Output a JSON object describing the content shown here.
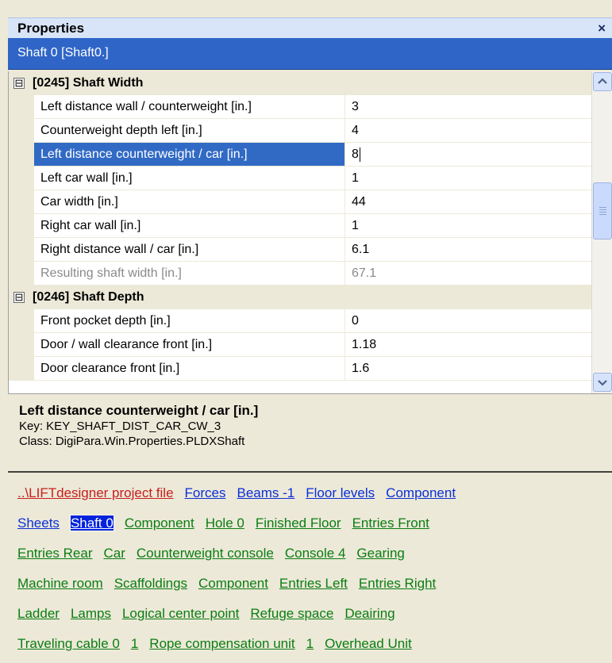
{
  "title": "Properties",
  "close_glyph": "×",
  "object_selector": "Shaft 0 [Shaft0.]",
  "categories": [
    {
      "label": "[0245] Shaft Width",
      "toggle": "⊟",
      "rows": [
        {
          "name": "Left distance wall  / counterweight [in.]",
          "value": "3"
        },
        {
          "name": "Counterweight depth left [in.]",
          "value": "4"
        },
        {
          "name": "Left distance counterweight / car [in.]",
          "value": "8"
        },
        {
          "name": "Left car wall [in.]",
          "value": "1"
        },
        {
          "name": "Car width [in.]",
          "value": "44"
        },
        {
          "name": "Right car wall [in.]",
          "value": "1"
        },
        {
          "name": "Right distance wall / car [in.]",
          "value": "6.1"
        },
        {
          "name": "Resulting shaft width [in.]",
          "value": "67.1"
        }
      ]
    },
    {
      "label": "[0246] Shaft Depth",
      "toggle": "⊟",
      "rows": [
        {
          "name": "Front pocket depth  [in.]",
          "value": "0"
        },
        {
          "name": "Door / wall clearance front [in.]",
          "value": "1.18"
        },
        {
          "name": "Door clearance front [in.]",
          "value": "1.6"
        }
      ]
    }
  ],
  "description": {
    "title": "Left distance counterweight / car [in.]",
    "key": "Key: KEY_SHAFT_DIST_CAR_CW_3",
    "class": "Class:  DigiPara.Win.Properties.PLDXShaft"
  },
  "links": [
    [
      {
        "label": "..\\LIFTdesigner project file",
        "color": "red"
      },
      {
        "label": "Forces",
        "color": "blue"
      },
      {
        "label": "Beams -1",
        "color": "blue"
      },
      {
        "label": "Floor levels",
        "color": "blue"
      },
      {
        "label": "Component",
        "color": "blue"
      }
    ],
    [
      {
        "label": "Sheets",
        "color": "blue"
      },
      {
        "label": "Shaft 0",
        "color": "blue",
        "selected": true
      },
      {
        "label": "Component",
        "color": "green"
      },
      {
        "label": "Hole 0",
        "color": "green"
      },
      {
        "label": "Finished Floor",
        "color": "green"
      },
      {
        "label": "Entries Front",
        "color": "green"
      }
    ],
    [
      {
        "label": "Entries Rear",
        "color": "green"
      },
      {
        "label": "Car",
        "color": "green"
      },
      {
        "label": "Counterweight console",
        "color": "green"
      },
      {
        "label": "Console 4",
        "color": "green"
      },
      {
        "label": "Gearing",
        "color": "green"
      }
    ],
    [
      {
        "label": "Machine room",
        "color": "green"
      },
      {
        "label": "Scaffoldings",
        "color": "green"
      },
      {
        "label": "Component",
        "color": "green"
      },
      {
        "label": "Entries Left",
        "color": "green"
      },
      {
        "label": "Entries Right",
        "color": "green"
      }
    ],
    [
      {
        "label": "Ladder",
        "color": "green"
      },
      {
        "label": "Lamps",
        "color": "green"
      },
      {
        "label": "Logical center point",
        "color": "green"
      },
      {
        "label": "Refuge space",
        "color": "green"
      },
      {
        "label": "Deairing",
        "color": "green"
      }
    ],
    [
      {
        "label": "Traveling cable 0",
        "color": "green"
      },
      {
        "label": "1",
        "color": "green"
      },
      {
        "label": "Rope compensation unit",
        "color": "green"
      },
      {
        "label": "1",
        "color": "green"
      },
      {
        "label": "Overhead Unit",
        "color": "green"
      }
    ]
  ],
  "colors": {
    "selection_blue": "#316ac5",
    "header_blue": "#2f65c7",
    "panel_beige": "#ece9d8",
    "link_red": "#c81e1e",
    "link_blue": "#0b2fd6",
    "link_green": "#0a7d12"
  },
  "icons": {
    "close": "close-icon",
    "scroll_up": "chevron-up-icon",
    "scroll_down": "chevron-down-icon",
    "collapse": "collapse-icon"
  }
}
